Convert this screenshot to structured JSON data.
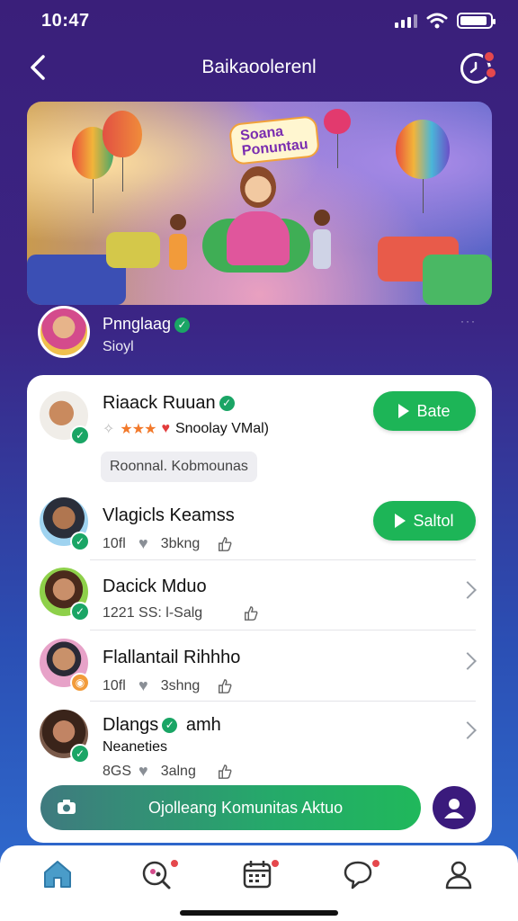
{
  "status_bar": {
    "time": "10:47",
    "battery_level": 0.9
  },
  "header": {
    "title": "Baikaoolerenl",
    "back_icon": "chevron-left-icon",
    "action_icon": "clock-icon"
  },
  "banner": {
    "chip_text": "Soana\nPonuntau"
  },
  "profile": {
    "name": "Pnnglaag",
    "subtitle": "Sioyl",
    "more": "···"
  },
  "list": [
    {
      "title": "Riaack Ruuan",
      "rating_text": "Snoolay VMal)",
      "stars": "★★★",
      "heart": "♥",
      "button": "Bate",
      "tag": "Roonnal.  Kobmounas"
    },
    {
      "title": "Vlagicls Keamss",
      "meta_a": "10fl",
      "meta_b": "3bkng",
      "button": "Saltol"
    },
    {
      "title": "Dacick Mduo",
      "meta_a": "1221  SS: l-Salg"
    },
    {
      "title": "Flallantail  Rihhho",
      "meta_a": "10fl",
      "meta_b": "3shng"
    },
    {
      "title": "Dlangs",
      "title_suffix": "amh",
      "subtitle": "Neaneties",
      "meta_a": "8GS",
      "meta_b": "3alng"
    }
  ],
  "cta": {
    "label": "Ojolleang Komunitas  Aktuo"
  },
  "colors": {
    "accent_green": "#1db557",
    "header_purple": "#3a1f7a",
    "badge_red": "#e5484d"
  },
  "tabs": [
    "home-icon",
    "search-people-icon",
    "calendar-icon",
    "chat-icon",
    "profile-icon"
  ]
}
